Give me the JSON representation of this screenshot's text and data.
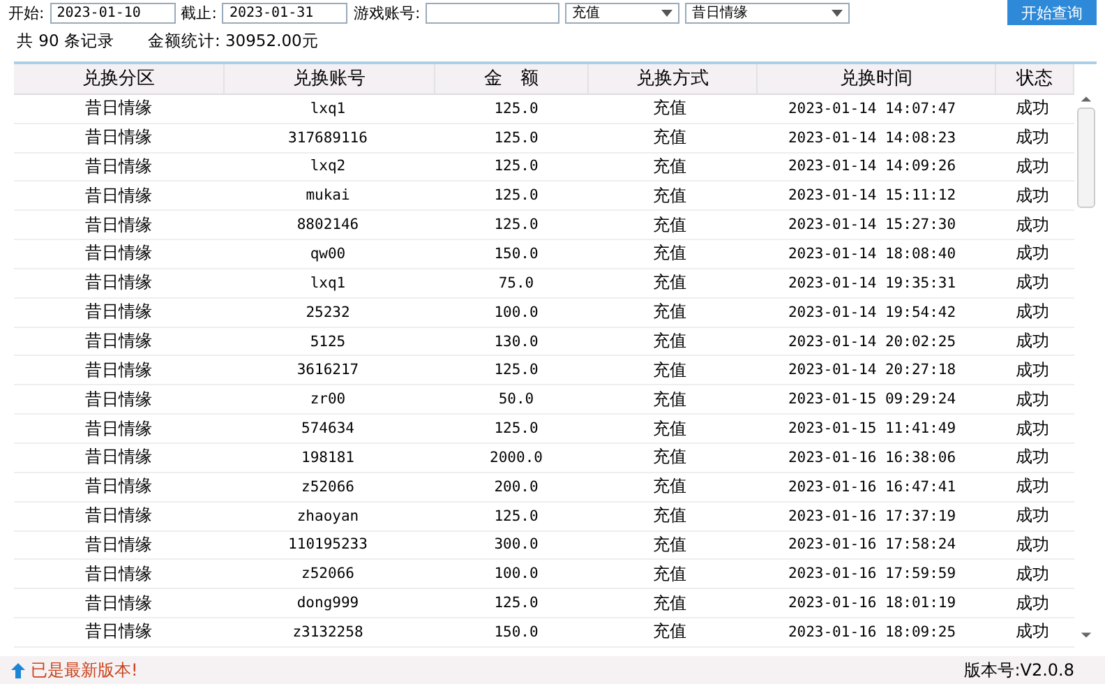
{
  "toolbar": {
    "start_label": "开始:",
    "start_value": "2023-01-10",
    "end_label": "截止:",
    "end_value": "2023-01-31",
    "account_label": "游戏账号:",
    "type_select": "充值",
    "zone_select": "昔日情缘",
    "query_button": "开始查询"
  },
  "summary": {
    "count": "共 90 条记录",
    "total": "金额统计: 30952.00元"
  },
  "table": {
    "columns": [
      "兑换分区",
      "兑换账号",
      "金　额",
      "兑换方式",
      "兑换时间",
      "状态"
    ],
    "rows": [
      [
        "昔日情缘",
        "lxq1",
        "125.0",
        "充值",
        "2023-01-14 14:07:47",
        "成功"
      ],
      [
        "昔日情缘",
        "317689116",
        "125.0",
        "充值",
        "2023-01-14 14:08:23",
        "成功"
      ],
      [
        "昔日情缘",
        "lxq2",
        "125.0",
        "充值",
        "2023-01-14 14:09:26",
        "成功"
      ],
      [
        "昔日情缘",
        "mukai",
        "125.0",
        "充值",
        "2023-01-14 15:11:12",
        "成功"
      ],
      [
        "昔日情缘",
        "8802146",
        "125.0",
        "充值",
        "2023-01-14 15:27:30",
        "成功"
      ],
      [
        "昔日情缘",
        "qw00",
        "150.0",
        "充值",
        "2023-01-14 18:08:40",
        "成功"
      ],
      [
        "昔日情缘",
        "lxq1",
        "75.0",
        "充值",
        "2023-01-14 19:35:31",
        "成功"
      ],
      [
        "昔日情缘",
        "25232",
        "100.0",
        "充值",
        "2023-01-14 19:54:42",
        "成功"
      ],
      [
        "昔日情缘",
        "5125",
        "130.0",
        "充值",
        "2023-01-14 20:02:25",
        "成功"
      ],
      [
        "昔日情缘",
        "3616217",
        "125.0",
        "充值",
        "2023-01-14 20:27:18",
        "成功"
      ],
      [
        "昔日情缘",
        "zr00",
        "50.0",
        "充值",
        "2023-01-15 09:29:24",
        "成功"
      ],
      [
        "昔日情缘",
        "574634",
        "125.0",
        "充值",
        "2023-01-15 11:41:49",
        "成功"
      ],
      [
        "昔日情缘",
        "198181",
        "2000.0",
        "充值",
        "2023-01-16 16:38:06",
        "成功"
      ],
      [
        "昔日情缘",
        "z52066",
        "200.0",
        "充值",
        "2023-01-16 16:47:41",
        "成功"
      ],
      [
        "昔日情缘",
        "zhaoyan",
        "125.0",
        "充值",
        "2023-01-16 17:37:19",
        "成功"
      ],
      [
        "昔日情缘",
        "110195233",
        "300.0",
        "充值",
        "2023-01-16 17:58:24",
        "成功"
      ],
      [
        "昔日情缘",
        "z52066",
        "100.0",
        "充值",
        "2023-01-16 17:59:59",
        "成功"
      ],
      [
        "昔日情缘",
        "dong999",
        "125.0",
        "充值",
        "2023-01-16 18:01:19",
        "成功"
      ],
      [
        "昔日情缘",
        "z3132258",
        "150.0",
        "充值",
        "2023-01-16 18:09:25",
        "成功"
      ]
    ]
  },
  "status_bar": {
    "update_message": "已是最新版本!",
    "version": "版本号:V2.0.8"
  }
}
